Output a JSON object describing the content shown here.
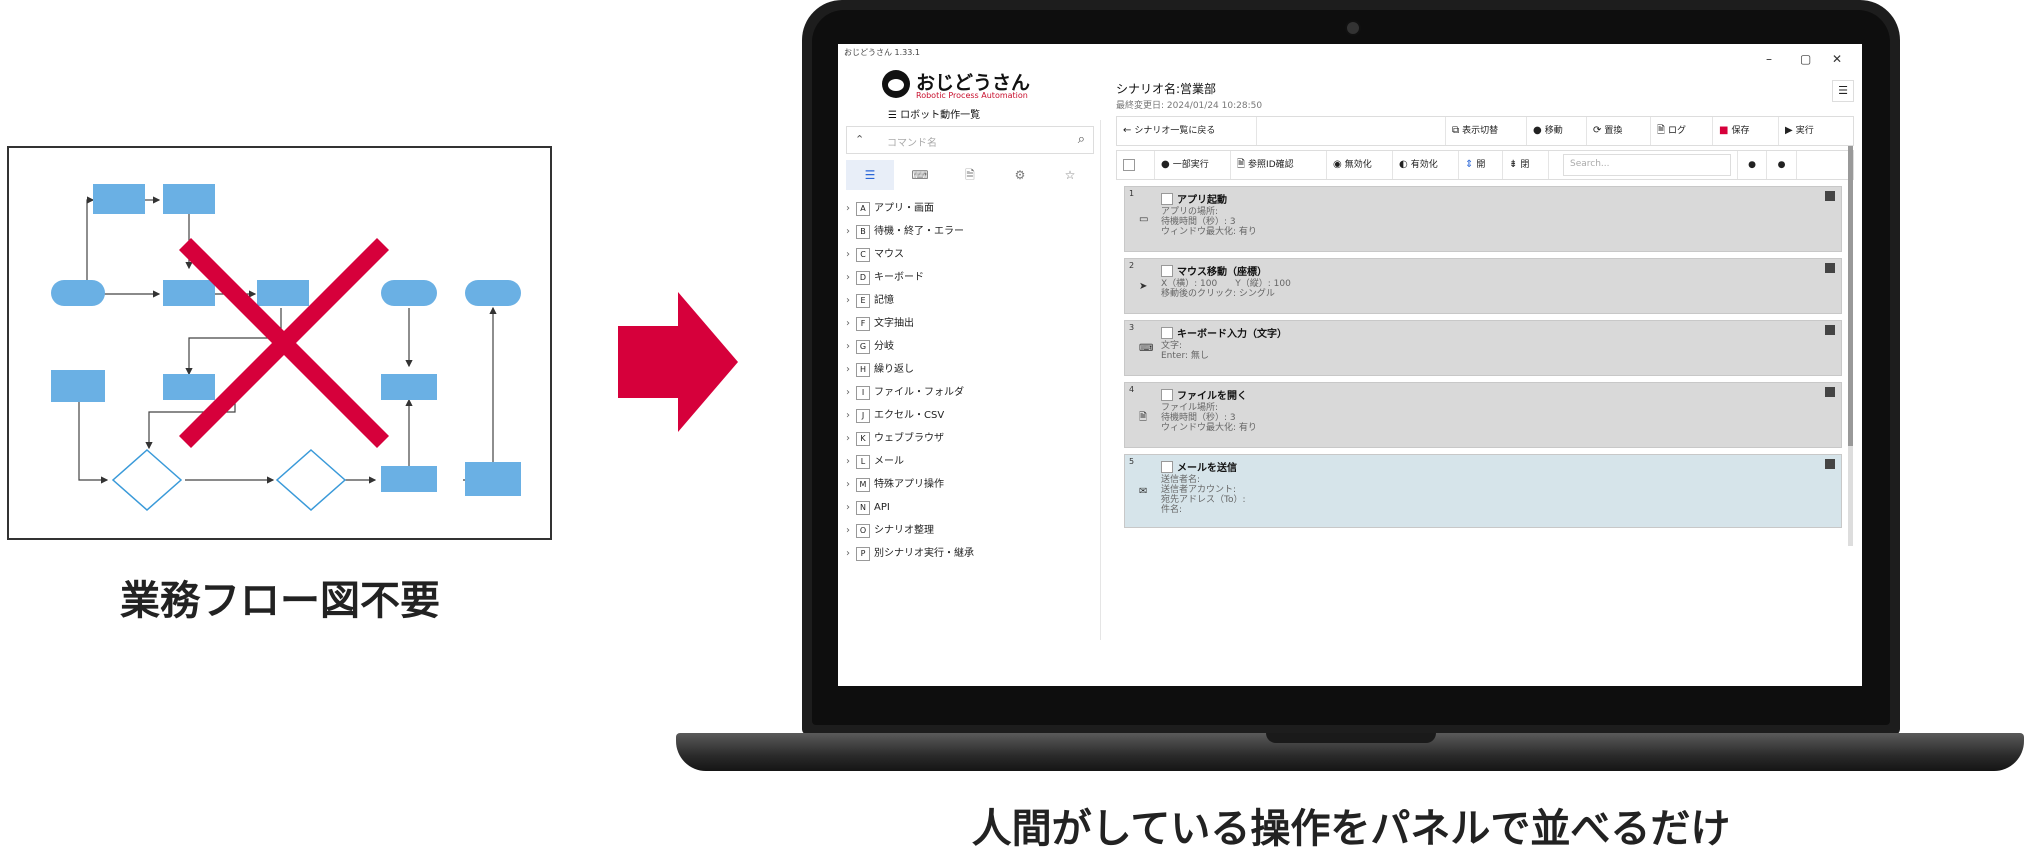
{
  "left_caption": "業務フロー図不要",
  "right_caption": "人間がしている操作をパネルで並べるだけ",
  "colors": {
    "flow_box": "#6ab0e4",
    "cross": "#d6003b",
    "arrow": "#d6003b",
    "laptop": "#1d1d1d"
  },
  "app": {
    "window_title": "おじどうさん 1.33.1",
    "window_controls": [
      "–",
      "▢",
      "✕"
    ],
    "name": "おじどうさん",
    "subtitle": "Robotic Process Automation",
    "robot_list_title": "ロボット動作一覧",
    "search_placeholder": "コマンド名",
    "category_tabs": [
      {
        "icon": "list-icon",
        "glyph": "☰"
      },
      {
        "icon": "keyboard-icon",
        "glyph": "⌨"
      },
      {
        "icon": "file-icon",
        "glyph": "🗎"
      },
      {
        "icon": "gear-icon",
        "glyph": "⚙"
      },
      {
        "icon": "star-icon",
        "glyph": "☆"
      }
    ],
    "categories": [
      {
        "key": "A",
        "label": "アプリ・画面"
      },
      {
        "key": "B",
        "label": "待機・終了・エラー"
      },
      {
        "key": "C",
        "label": "マウス"
      },
      {
        "key": "D",
        "label": "キーボード"
      },
      {
        "key": "E",
        "label": "記憶"
      },
      {
        "key": "F",
        "label": "文字抽出"
      },
      {
        "key": "G",
        "label": "分岐"
      },
      {
        "key": "H",
        "label": "繰り返し"
      },
      {
        "key": "I",
        "label": "ファイル・フォルダ"
      },
      {
        "key": "J",
        "label": "エクセル・CSV"
      },
      {
        "key": "K",
        "label": "ウェブブラウザ"
      },
      {
        "key": "L",
        "label": "メール"
      },
      {
        "key": "M",
        "label": "特殊アプリ操作"
      },
      {
        "key": "N",
        "label": "API"
      },
      {
        "key": "O",
        "label": "シナリオ整理"
      },
      {
        "key": "P",
        "label": "別シナリオ実行・継承"
      }
    ],
    "scenario_name": "シナリオ名:営業部",
    "last_modified": "最終変更日: 2024/01/24 10:28:50",
    "toolbar1": {
      "back": "シナリオ一覧に戻る",
      "display_toggle": "表示切替",
      "move": "移動",
      "replace": "置換",
      "log": "ログ",
      "save": "保存",
      "run": "実行"
    },
    "toolbar2": {
      "partial_run": "一部実行",
      "ref_check": "参照ID確認",
      "disable": "無効化",
      "enable": "有効化",
      "open": "開",
      "close": "閉",
      "search_placeholder": "Search..."
    },
    "steps": [
      {
        "num": "1",
        "title": "アプリ起動",
        "icon": "window-icon",
        "glyph": "▭",
        "lines": [
          "アプリの場所:",
          "待機時間（秒）: 3",
          "ウィンドウ最大化: 有り"
        ]
      },
      {
        "num": "2",
        "title": "マウス移動（座標）",
        "icon": "cursor-icon",
        "glyph": "➤",
        "lines": [
          "X（横）: 100　　Y（縦）: 100",
          "移動後のクリック: シングル"
        ]
      },
      {
        "num": "3",
        "title": "キーボード入力（文字）",
        "icon": "keyboard-icon",
        "glyph": "⌨",
        "lines": [
          "文字:",
          "Enter: 無し"
        ]
      },
      {
        "num": "4",
        "title": "ファイルを開く",
        "icon": "file-icon",
        "glyph": "🗎",
        "lines": [
          "ファイル場所:",
          "待機時間（秒）: 3",
          "ウィンドウ最大化: 有り"
        ]
      },
      {
        "num": "5",
        "title": "メールを送信",
        "icon": "mail-icon",
        "glyph": "✉",
        "lines": [
          "送信者名:",
          "送信者アカウント:",
          "宛先アドレス（To）:",
          "件名:"
        ]
      }
    ]
  }
}
